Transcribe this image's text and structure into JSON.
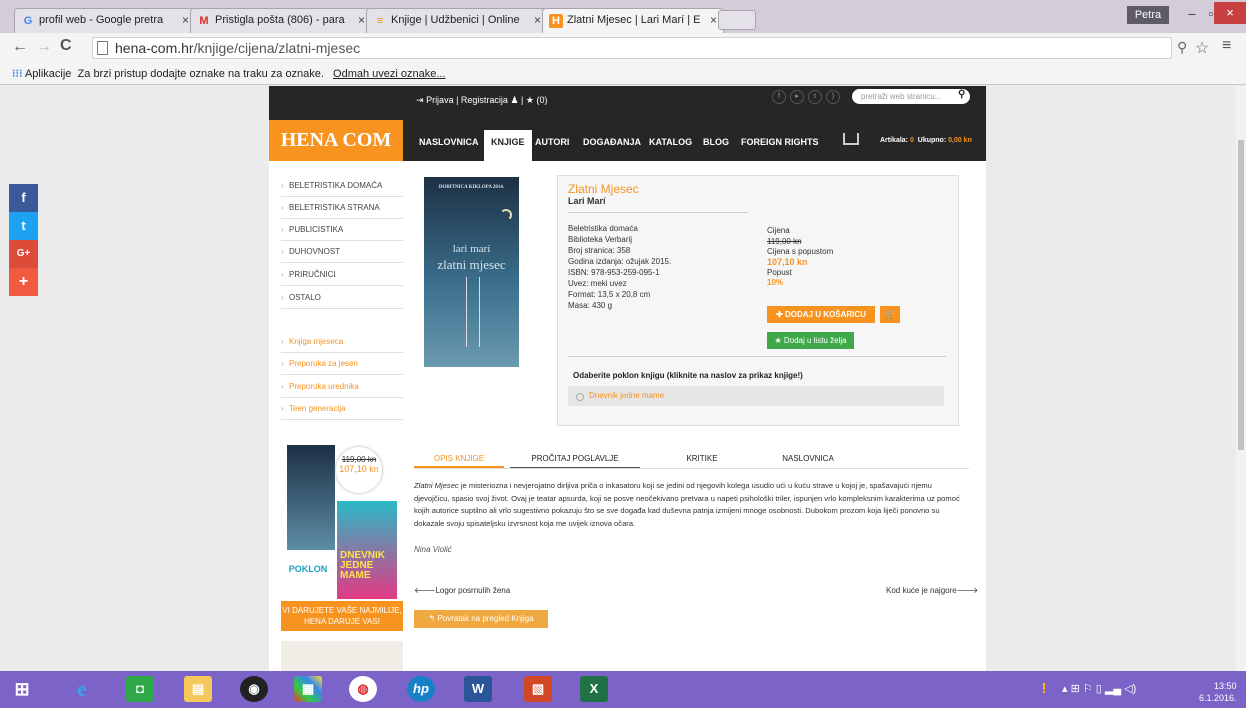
{
  "browser": {
    "tabs": [
      {
        "title": "profil web - Google pretra",
        "icon": "G",
        "color": "#4285f4"
      },
      {
        "title": "Pristigla pošta (806) - para",
        "icon": "M",
        "color": "#d93025"
      },
      {
        "title": "Knjige | Udžbenici | Online",
        "icon": "≡",
        "color": "#e0a020"
      },
      {
        "title": "Zlatni Mjesec | Lari Marí | E",
        "icon": "H",
        "color": "#f7931e"
      }
    ],
    "user": "Petra",
    "url_host": "hena-com.hr",
    "url_path": "/knjige/cijena/zlatni-mjesec",
    "bookmarks_apps": "Aplikacije",
    "bookmarks_hint": "Za brzi pristup dodajte oznake na traku za oznake.",
    "bookmarks_link": "Odmah uvezi oznake..."
  },
  "site": {
    "logo": "HENA COM",
    "login": "Prijava",
    "register": "Registracija",
    "wishlist_count": "(0)",
    "search_placeholder": "pretraži web stranicu...",
    "nav": [
      "NASLOVNICA",
      "KNJIGE",
      "AUTORI",
      "DOGAĐANJA",
      "KATALOG",
      "BLOG",
      "FOREIGN RIGHTS"
    ],
    "cart_items_label": "Artikala:",
    "cart_items": "0",
    "cart_total_label": "Ukupno:",
    "cart_total": "0,00 kn"
  },
  "categories": [
    "BELETRISTIKA DOMAĆA",
    "BELETRISTIKA STRANA",
    "PUBLICISTIKA",
    "DUHOVNOST",
    "PRIRUČNICI",
    "OSTALO"
  ],
  "specials": [
    "Knjiga mjeseca",
    "Preporuka za jesen",
    "Preporuka urednika",
    "Teen generacija"
  ],
  "book": {
    "title": "Zlatni Mjesec",
    "author": "Lari Marí",
    "cover_top": "DOBITNICA KIKLOPA 2014.",
    "cover_author": "lari marí",
    "cover_title": "zlatni mjesec",
    "details": [
      "Beletristika domaća",
      "Biblioteka Verbarij",
      "Broj stranica: 358",
      "Godina izdanja: ožujak 2015.",
      "ISBN: 978-953-259-095-1",
      "Uvez: meki uvez",
      "Format: 13,5 x 20,8 cm",
      "Masa: 430 g"
    ],
    "price_label": "Cijena",
    "price_old": "119,00 kn",
    "discount_label": "Cijena s popustom",
    "price_new": "107,10 kn",
    "popust_label": "Popust",
    "popust": "10%",
    "add_to_cart": "DODAJ U KOŠARICU",
    "add_wish": "Dodaj u listu želja",
    "gift_heading": "Odaberite poklon knjigu (kliknite na naslov za prikaz knjige!)",
    "gift_book": "Dnevnik jedne mame"
  },
  "promo": {
    "old": "119,00 kn",
    "new": "107,10 kn",
    "poklon": "POKLON",
    "gift_text": "DNEVNIK JEDNE MAME",
    "caption": "VI DARUJETE VAŠE NAJMILIJE, HENA DARUJE VAS!"
  },
  "tabs": [
    "OPIS KNJIGE",
    "PROČITAJ POGLAVLJE",
    "KRITIKE",
    "NASLOVNICA"
  ],
  "description": {
    "em": "Zlatni Mjesec",
    "text": " je misteriozna i nevjerojatno dirljiva priča o inkasatoru koji se jedini od njegovih kolega usudio ući u kuću strave u kojoj je, spašavajući njemu djevojčicu, spasio svoj život. Ovaj je teatar apsurda, koji se posve neočekivano pretvara u napeti psihološki triler, ispunjen vrlo kompleksnim karakterima uz pomoć kojih autorice suptilno ali vrlo sugestivno pokazuju što se sve događa kad duševna patnja izmijeni mnoge osobnosti. Dubokom prozom koja liječi ponovno su dokazale svoju spisateljsku izvrsnost koja me uvijek iznova očara.",
    "signature": "Nina Violić"
  },
  "pager": {
    "prev": "Logor posrnulih žena",
    "next": "Kod kuće je najgore",
    "back": "Povratak na pregled Knjiga"
  },
  "taskbar": {
    "time": "13:50",
    "date": "6.1.2016."
  }
}
